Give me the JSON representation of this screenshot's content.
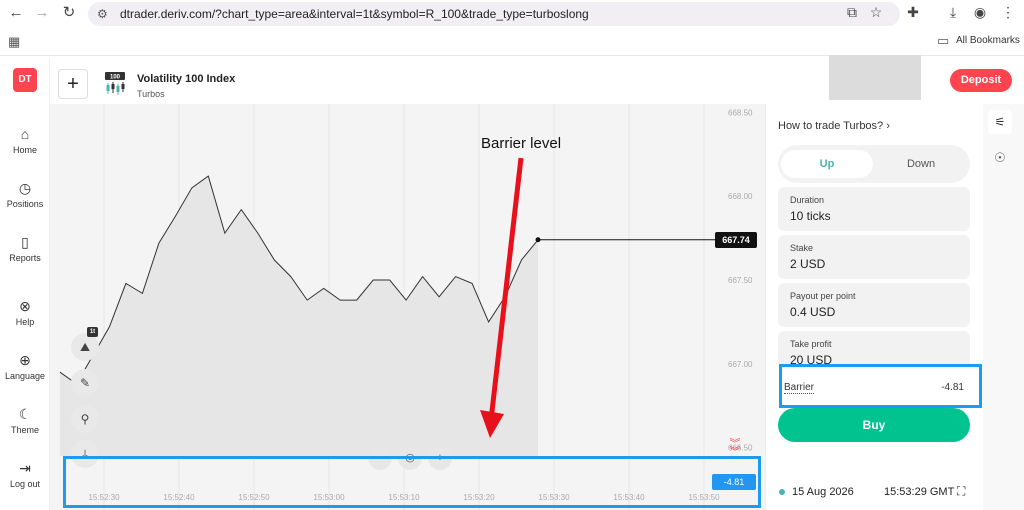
{
  "browser": {
    "url": "dtrader.deriv.com/?chart_type=area&interval=1t&symbol=R_100&trade_type=turboslong",
    "bookmarks_label": "All Bookmarks"
  },
  "sidebar": {
    "logo": "DT",
    "items": [
      {
        "label": "Home",
        "icon": "home-icon"
      },
      {
        "label": "Positions",
        "icon": "clock-icon"
      },
      {
        "label": "Reports",
        "icon": "document-icon"
      },
      {
        "label": "Help",
        "icon": "lifebuoy-icon"
      },
      {
        "label": "Language",
        "icon": "globe-icon"
      },
      {
        "label": "Theme",
        "icon": "moon-icon"
      },
      {
        "label": "Log out",
        "icon": "logout-icon"
      }
    ]
  },
  "market": {
    "name": "Volatility 100 Index",
    "type": "Turbos",
    "badge": "100"
  },
  "header": {
    "deposit_label": "Deposit"
  },
  "chart_data": {
    "type": "area",
    "y_ticks": [
      "668.50",
      "668.00",
      "667.50",
      "667.00",
      "666.50"
    ],
    "x_ticks": [
      "15:52:30",
      "15:52:40",
      "15:52:50",
      "15:53:00",
      "15:53:10",
      "15:53:20",
      "15:53:30",
      "15:53:40",
      "15:53:50"
    ],
    "ylim": [
      666.45,
      668.55
    ],
    "values": [
      666.95,
      666.88,
      667.05,
      667.22,
      667.48,
      667.42,
      667.72,
      667.88,
      668.05,
      668.12,
      667.78,
      667.92,
      667.78,
      667.62,
      667.52,
      667.38,
      667.45,
      667.38,
      667.38,
      667.5,
      667.5,
      667.38,
      667.52,
      667.4,
      667.52,
      667.48,
      667.25,
      667.4,
      667.62,
      667.74
    ],
    "current_price": "667.74",
    "barrier_value": "-4.81",
    "barrier_price": 666.08,
    "annotation": "Barrier level",
    "ticks_badge": "1t"
  },
  "trade": {
    "how_to": "How to trade Turbos?",
    "up_label": "Up",
    "down_label": "Down",
    "duration_label": "Duration",
    "duration_value": "10 ticks",
    "stake_label": "Stake",
    "stake_value": "2 USD",
    "payout_label": "Payout per point",
    "payout_value": "0.4 USD",
    "take_profit_label": "Take profit",
    "take_profit_value": "20 USD",
    "barrier_label": "Barrier",
    "barrier_value": "-4.81",
    "buy_label": "Buy"
  },
  "status": {
    "date": "15 Aug 2026",
    "time": "15:53:29 GMT"
  },
  "colors": {
    "brand_red": "#ff444f",
    "buy_green": "#00c390",
    "up_teal": "#4bb4b3",
    "highlight_blue": "#1d9bf0"
  }
}
